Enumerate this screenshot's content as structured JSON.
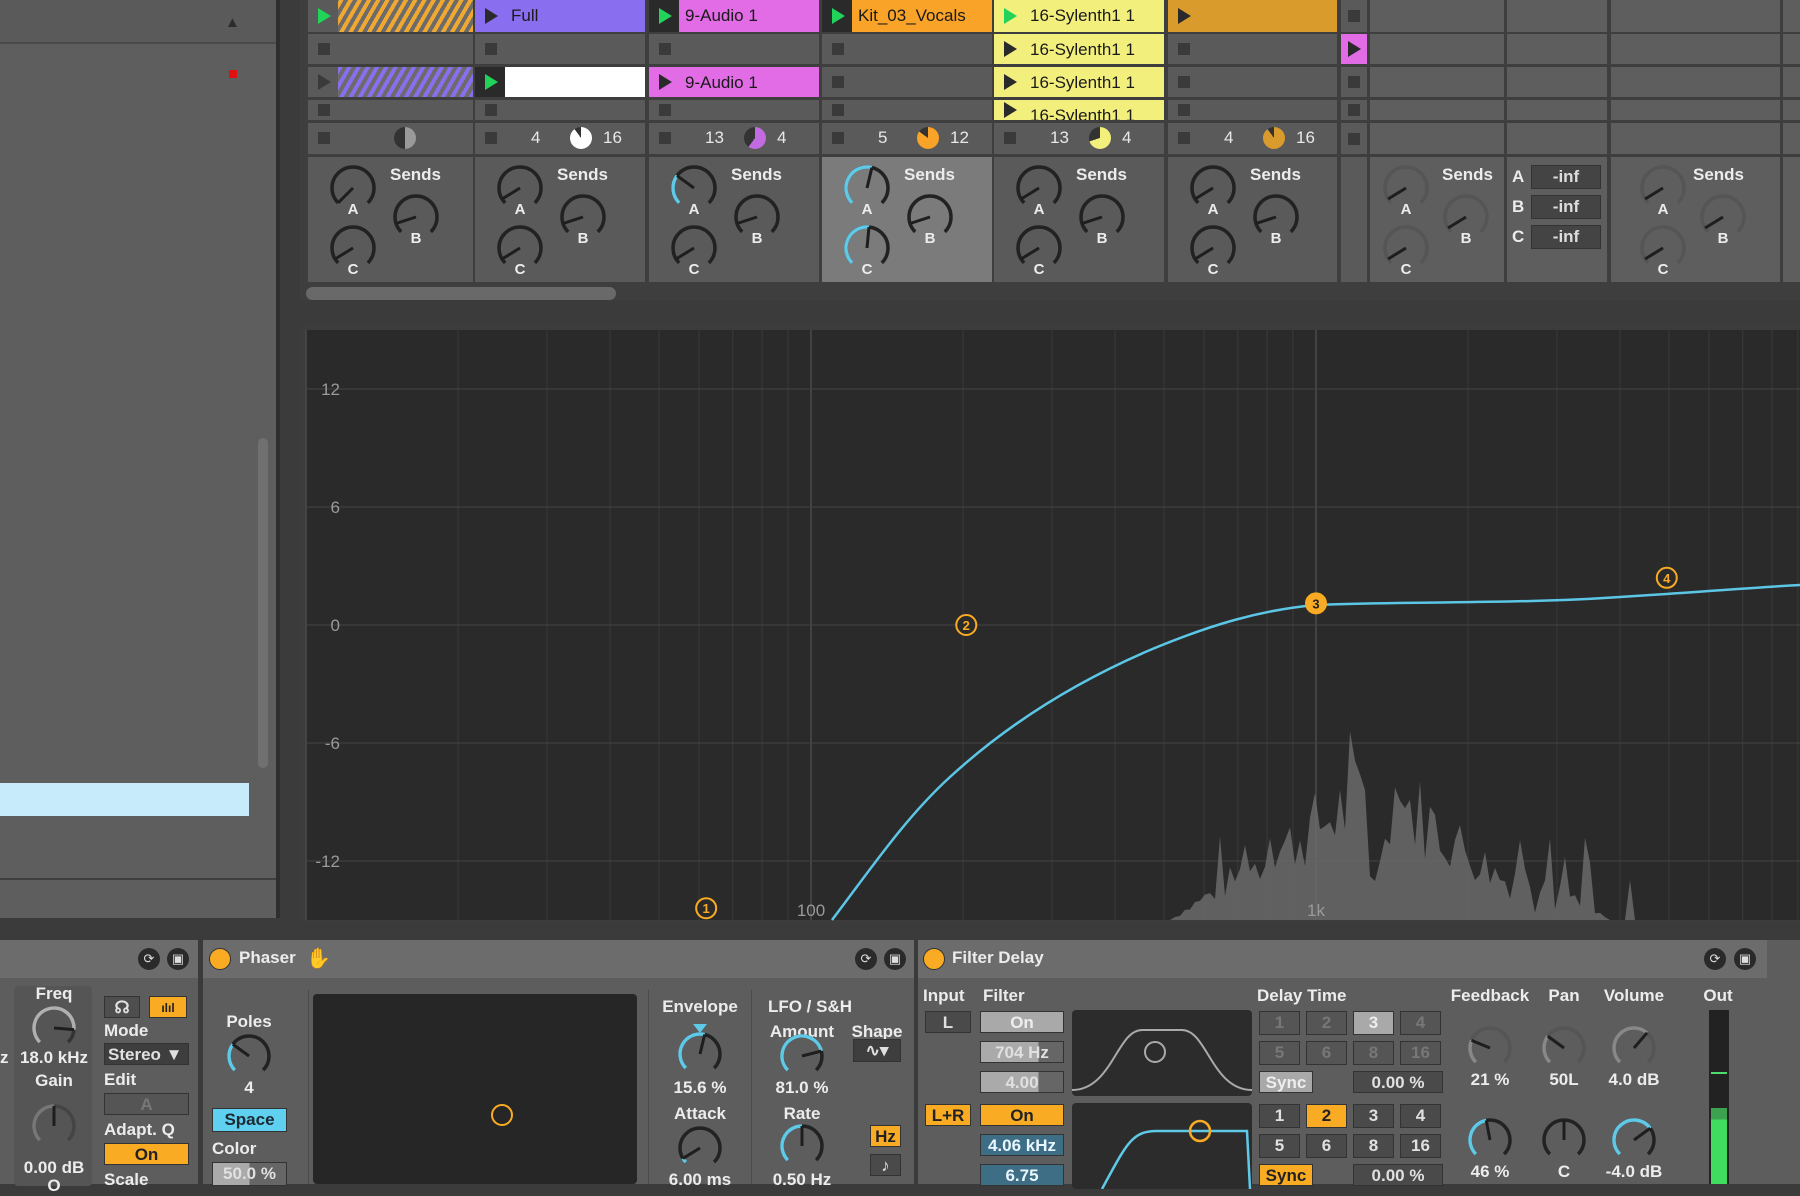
{
  "colors": {
    "accent": "#5fc9e8",
    "orange": "#f9ab23",
    "purple": "#8a6ef0",
    "pink": "#e26be6",
    "yellow": "#f3ef7d",
    "brown": "#d89b2c",
    "green": "#23d15a"
  },
  "left_panel": {
    "scroll_up": "▲"
  },
  "session": {
    "tracks": [
      {
        "clips": [
          {
            "row": 0,
            "color": "#f0a830",
            "hatched": true,
            "playing": true
          },
          {
            "row": 2,
            "color": "#8a6ef0",
            "hatched": true
          }
        ],
        "counts": [
          "",
          ""
        ],
        "pie_color": "#9a9a9a",
        "pie": 0.5,
        "sends": {
          "A": 0,
          "B": 0.1,
          "C": 0.05
        }
      },
      {
        "clips": [
          {
            "row": 0,
            "name": "Full",
            "color": "#8a6ef0"
          },
          {
            "row": 2,
            "name": "",
            "color": "#ffffff",
            "playing": true
          }
        ],
        "counts": [
          "4",
          "16"
        ],
        "pie_color": "#ffffff",
        "pie": 0.9,
        "sends": {
          "A": 0.05,
          "B": 0.1,
          "C": 0.05
        }
      },
      {
        "clips": [
          {
            "row": 0,
            "name": "9-Audio 1",
            "color": "#e26be6",
            "playing": true
          },
          {
            "row": 2,
            "name": "9-Audio 1",
            "color": "#e26be6"
          }
        ],
        "counts": [
          "13",
          "4"
        ],
        "pie_color": "#c26be0",
        "pie": 0.6,
        "sends": {
          "A": 0.3,
          "B": 0.1,
          "C": 0.05
        }
      },
      {
        "clips": [
          {
            "row": 0,
            "name": "Kit_03_Vocals",
            "color": "#f9a329",
            "playing": true
          }
        ],
        "counts": [
          "5",
          "12"
        ],
        "pie_color": "#f9a329",
        "pie": 0.85,
        "sends": {
          "A": 0.55,
          "B": 0.1,
          "C": 0.52
        },
        "selected": true
      },
      {
        "clips": [
          {
            "row": 0,
            "name": "16-Sylenth1 1",
            "color": "#f3ef7d",
            "playing": true
          },
          {
            "row": 1,
            "name": "16-Sylenth1 1",
            "color": "#f3ef7d"
          },
          {
            "row": 2,
            "name": "16-Sylenth1 1",
            "color": "#f3ef7d"
          },
          {
            "row": 3,
            "name": "16-Sylenth1 1",
            "color": "#f3ef7d"
          }
        ],
        "counts": [
          "13",
          "4"
        ],
        "pie_color": "#f3ef7d",
        "pie": 0.7,
        "sends": {
          "A": 0.05,
          "B": 0.1,
          "C": 0.05
        }
      },
      {
        "clips": [
          {
            "row": 0,
            "name": "",
            "color": "#d89b2c"
          }
        ],
        "counts": [
          "4",
          "16"
        ],
        "pie_color": "#d89b2c",
        "pie": 0.9,
        "sends": {
          "A": 0.05,
          "B": 0.1,
          "C": 0.05
        }
      }
    ],
    "sends_label": "Sends",
    "send_letters": [
      "A",
      "B",
      "C"
    ],
    "returns": {
      "values": [
        "-inf",
        "-inf",
        "-inf"
      ]
    }
  },
  "eq": {
    "y_ticks": [
      "12",
      "6",
      "0",
      "-6",
      "-12"
    ],
    "x_ticks": [
      "100",
      "1k"
    ],
    "bands": [
      {
        "label": "1",
        "freq_hz": 62,
        "gain_db": -14.4
      },
      {
        "label": "2",
        "freq_hz": 203,
        "gain_db": 0
      },
      {
        "label": "3",
        "freq_hz": 1000,
        "gain_db": 1.1
      },
      {
        "label": "4",
        "freq_hz": 4950,
        "gain_db": 2.4
      }
    ]
  },
  "eq_device": {
    "freq_label": "Freq",
    "freq_value": "18.0 kHz",
    "freq_unit_cut": "z",
    "gain_label": "Gain",
    "gain_value": "0.00 dB",
    "mode_label": "Mode",
    "mode_value": "Stereo ▼",
    "edit_label": "Edit",
    "edit_value": "A",
    "adaptq_label": "Adapt. Q",
    "adaptq_value": "On",
    "scale_label": "Scale",
    "bottom_cut": "O"
  },
  "phaser": {
    "title": "Phaser",
    "poles_label": "Poles",
    "poles_value": "4",
    "space_label": "Space",
    "color_label": "Color",
    "color_value": "50.0 %",
    "envelope_label": "Envelope",
    "envelope_value": "15.6 %",
    "attack_label": "Attack",
    "attack_value": "6.00 ms",
    "lfo_label": "LFO / S&H",
    "amount_label": "Amount",
    "amount_value": "81.0 %",
    "shape_label": "Shape",
    "shape_value": "∿▾",
    "rate_label": "Rate",
    "rate_value": "0.50 Hz",
    "hz_label": "Hz",
    "note_label": "♪"
  },
  "filter_delay": {
    "title": "Filter Delay",
    "input_label": "Input",
    "filter_label": "Filter",
    "delay_label": "Delay Time",
    "feedback_label": "Feedback",
    "pan_label": "Pan",
    "volume_label": "Volume",
    "out_label": "Out",
    "ch1": {
      "input": "L",
      "filter_on": "On",
      "freq": "704 Hz",
      "q": "4.00",
      "sync": "Sync",
      "offset": "0.00 %",
      "feedback": "21 %",
      "pan": "50L",
      "volume": "4.0 dB",
      "selected_div": "3"
    },
    "ch2": {
      "input": "L+R",
      "filter_on": "On",
      "freq": "4.06 kHz",
      "q": "6.75",
      "sync": "Sync",
      "offset": "0.00 %",
      "feedback": "46 %",
      "pan": "C",
      "volume": "-4.0 dB",
      "selected_div": "2"
    },
    "divisions": [
      "1",
      "2",
      "3",
      "4",
      "5",
      "6",
      "8",
      "16"
    ]
  }
}
